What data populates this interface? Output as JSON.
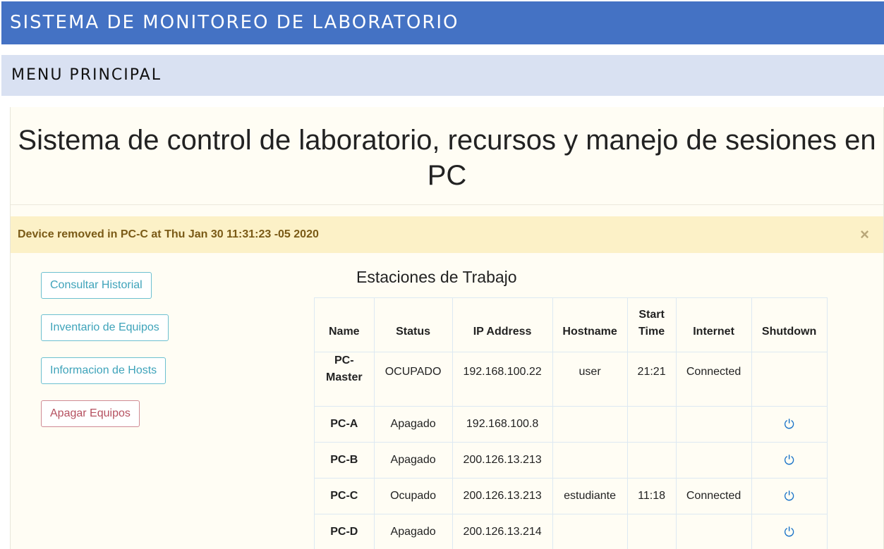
{
  "header": {
    "title": "SISTEMA DE MONITOREO DE LABORATORIO"
  },
  "menu": {
    "title": "MENU PRINCIPAL"
  },
  "page": {
    "title": "Sistema de control de laboratorio, recursos y manejo de sesiones en PC"
  },
  "alert": {
    "message": "Device removed in PC-C at Thu Jan 30 11:31:23 -05 2020",
    "close": "×"
  },
  "sidebar": {
    "buttons": [
      "Consultar Historial",
      "Inventario de Equipos",
      "Informacion de Hosts",
      "Apagar Equipos"
    ]
  },
  "stations": {
    "title": "Estaciones de Trabajo",
    "columns": [
      "Name",
      "Status",
      "IP Address",
      "Hostname",
      "Start Time",
      "Internet",
      "Shutdown"
    ],
    "power_glyph": "⏻",
    "rows": [
      {
        "name": "PC-Master",
        "status": "OCUPADO",
        "ip": "192.168.100.22",
        "hostname": "user",
        "start": "21:21",
        "internet": "Connected",
        "shutdown": false
      },
      {
        "name": "PC-A",
        "status": "Apagado",
        "ip": "192.168.100.8",
        "hostname": "",
        "start": "",
        "internet": "",
        "shutdown": true
      },
      {
        "name": "PC-B",
        "status": "Apagado",
        "ip": "200.126.13.213",
        "hostname": "",
        "start": "",
        "internet": "",
        "shutdown": true
      },
      {
        "name": "PC-C",
        "status": "Ocupado",
        "ip": "200.126.13.213",
        "hostname": "estudiante",
        "start": "11:18",
        "internet": "Connected",
        "shutdown": true
      },
      {
        "name": "PC-D",
        "status": "Apagado",
        "ip": "200.126.13.214",
        "hostname": "",
        "start": "",
        "internet": "",
        "shutdown": true
      }
    ]
  }
}
